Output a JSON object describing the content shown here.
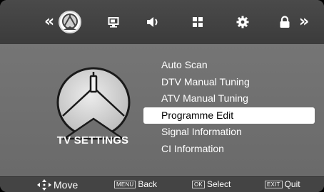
{
  "topbar": {
    "left_arrow": "«",
    "right_arrow": "»",
    "icons": [
      "satellite-dish-icon",
      "picture-icon",
      "speaker-icon",
      "grid-icon",
      "gear-icon",
      "lock-icon"
    ],
    "selected_icon": "satellite-dish-icon"
  },
  "main": {
    "section_title": "TV SETTINGS",
    "menu_items": [
      {
        "label": "Auto Scan",
        "selected": false
      },
      {
        "label": "DTV Manual Tuning",
        "selected": false
      },
      {
        "label": "ATV Manual Tuning",
        "selected": false
      },
      {
        "label": "Programme Edit",
        "selected": true
      },
      {
        "label": "Signal Information",
        "selected": false
      },
      {
        "label": "CI Information",
        "selected": false
      }
    ]
  },
  "bottombar": {
    "move_label": "Move",
    "menu_key": "MENU",
    "menu_label": "Back",
    "ok_key": "OK",
    "ok_label": "Select",
    "exit_key": "EXIT",
    "exit_label": "Quit"
  },
  "colors": {
    "topbar": "#3f3f3f",
    "body": "#6f6f6f",
    "bottombar": "#444444",
    "selected_row": "#ffffff",
    "text": "#ffffff"
  }
}
